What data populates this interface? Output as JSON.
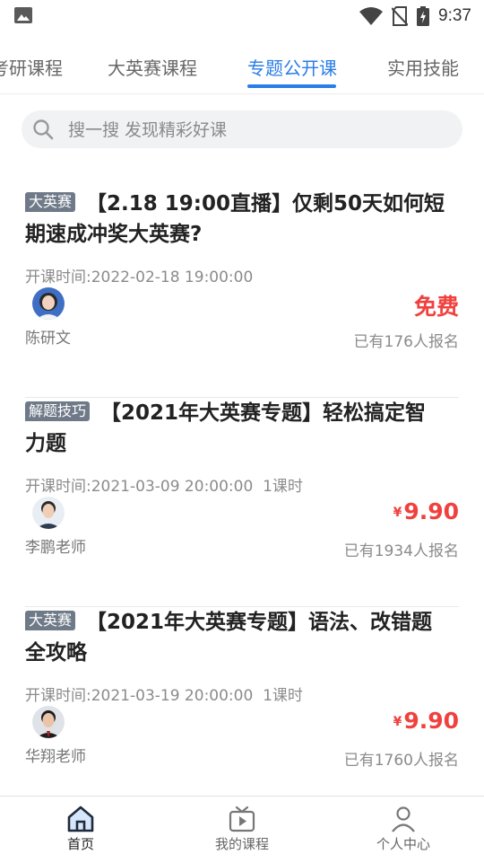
{
  "status_bar": {
    "time": "9:37"
  },
  "tabs": [
    {
      "label": "考研课程"
    },
    {
      "label": "大英赛课程"
    },
    {
      "label": "专题公开课"
    },
    {
      "label": "实用技能"
    }
  ],
  "search": {
    "placeholder": "搜一搜 发现精彩好课"
  },
  "courses": [
    {
      "tag": "大英赛",
      "title": "【2.18 19:00直播】仅剩50天如何短期速成冲奖大英赛?",
      "time_label": "开课时间:",
      "time": "2022-02-18 19:00:00",
      "lessons": "",
      "teacher": "陈研文",
      "price": "免费",
      "currency": "",
      "enrolled": "已有176人报名"
    },
    {
      "tag": "解题技巧",
      "title": "【2021年大英赛专题】轻松搞定智力题",
      "time_label": "开课时间:",
      "time": "2021-03-09 20:00:00",
      "lessons": "1课时",
      "teacher": "李鹏老师",
      "price": "9.90",
      "currency": "¥",
      "enrolled": "已有1934人报名"
    },
    {
      "tag": "大英赛",
      "title": "【2021年大英赛专题】语法、改错题全攻略",
      "time_label": "开课时间:",
      "time": "2021-03-19 20:00:00",
      "lessons": "1课时",
      "teacher": "华翔老师",
      "price": "9.90",
      "currency": "¥",
      "enrolled": "已有1760人报名"
    }
  ],
  "bottom_nav": [
    {
      "label": "首页"
    },
    {
      "label": "我的课程"
    },
    {
      "label": "个人中心"
    }
  ],
  "colors": {
    "accent": "#2a7ee6",
    "price": "#f0413e",
    "tag_bg": "#6f7a88"
  }
}
